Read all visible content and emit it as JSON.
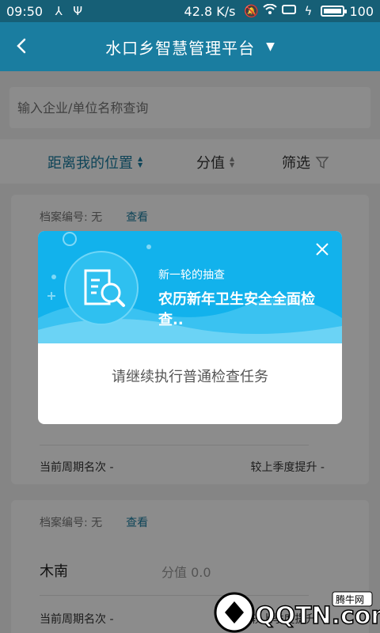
{
  "status_bar": {
    "time": "09:50",
    "icons": [
      "usb-share-icon",
      "usb-icon"
    ],
    "speed": "42.8 K/s",
    "right_icons": [
      "mute-icon",
      "wifi-icon",
      "screen-icon",
      "charging-icon"
    ],
    "battery_percent": 100,
    "battery_label": "100"
  },
  "header": {
    "title": "水口乡智慧管理平台",
    "caret": "▼"
  },
  "search": {
    "placeholder": "输入企业/单位名称查询"
  },
  "sort_bar": {
    "distance_label": "距离我的位置",
    "score_label": "分值",
    "filter_label": "筛选"
  },
  "cards": [
    {
      "file_no": "档案编号: 无",
      "view_label": "查看",
      "period_rank": "当前周期名次  -",
      "quarter_up": "较上季度提升  -"
    },
    {
      "file_no": "档案编号: 无",
      "view_label": "查看",
      "name": "木南",
      "score": "分值  0.0",
      "period_rank": "当前周期名次  -",
      "quarter_up": "较上季度提升  -"
    }
  ],
  "modal": {
    "subtitle": "新一轮的抽查",
    "title": "农历新年卫生安全全面检查..",
    "message": "请继续执行普通检查任务"
  },
  "watermark": {
    "text": "QQTN.com",
    "badge": "腾牛网"
  },
  "colors": {
    "status_bar": "#165f76",
    "header": "#1a7da0",
    "accent": "#1a7da0",
    "modal_top": "#12b2ec"
  }
}
